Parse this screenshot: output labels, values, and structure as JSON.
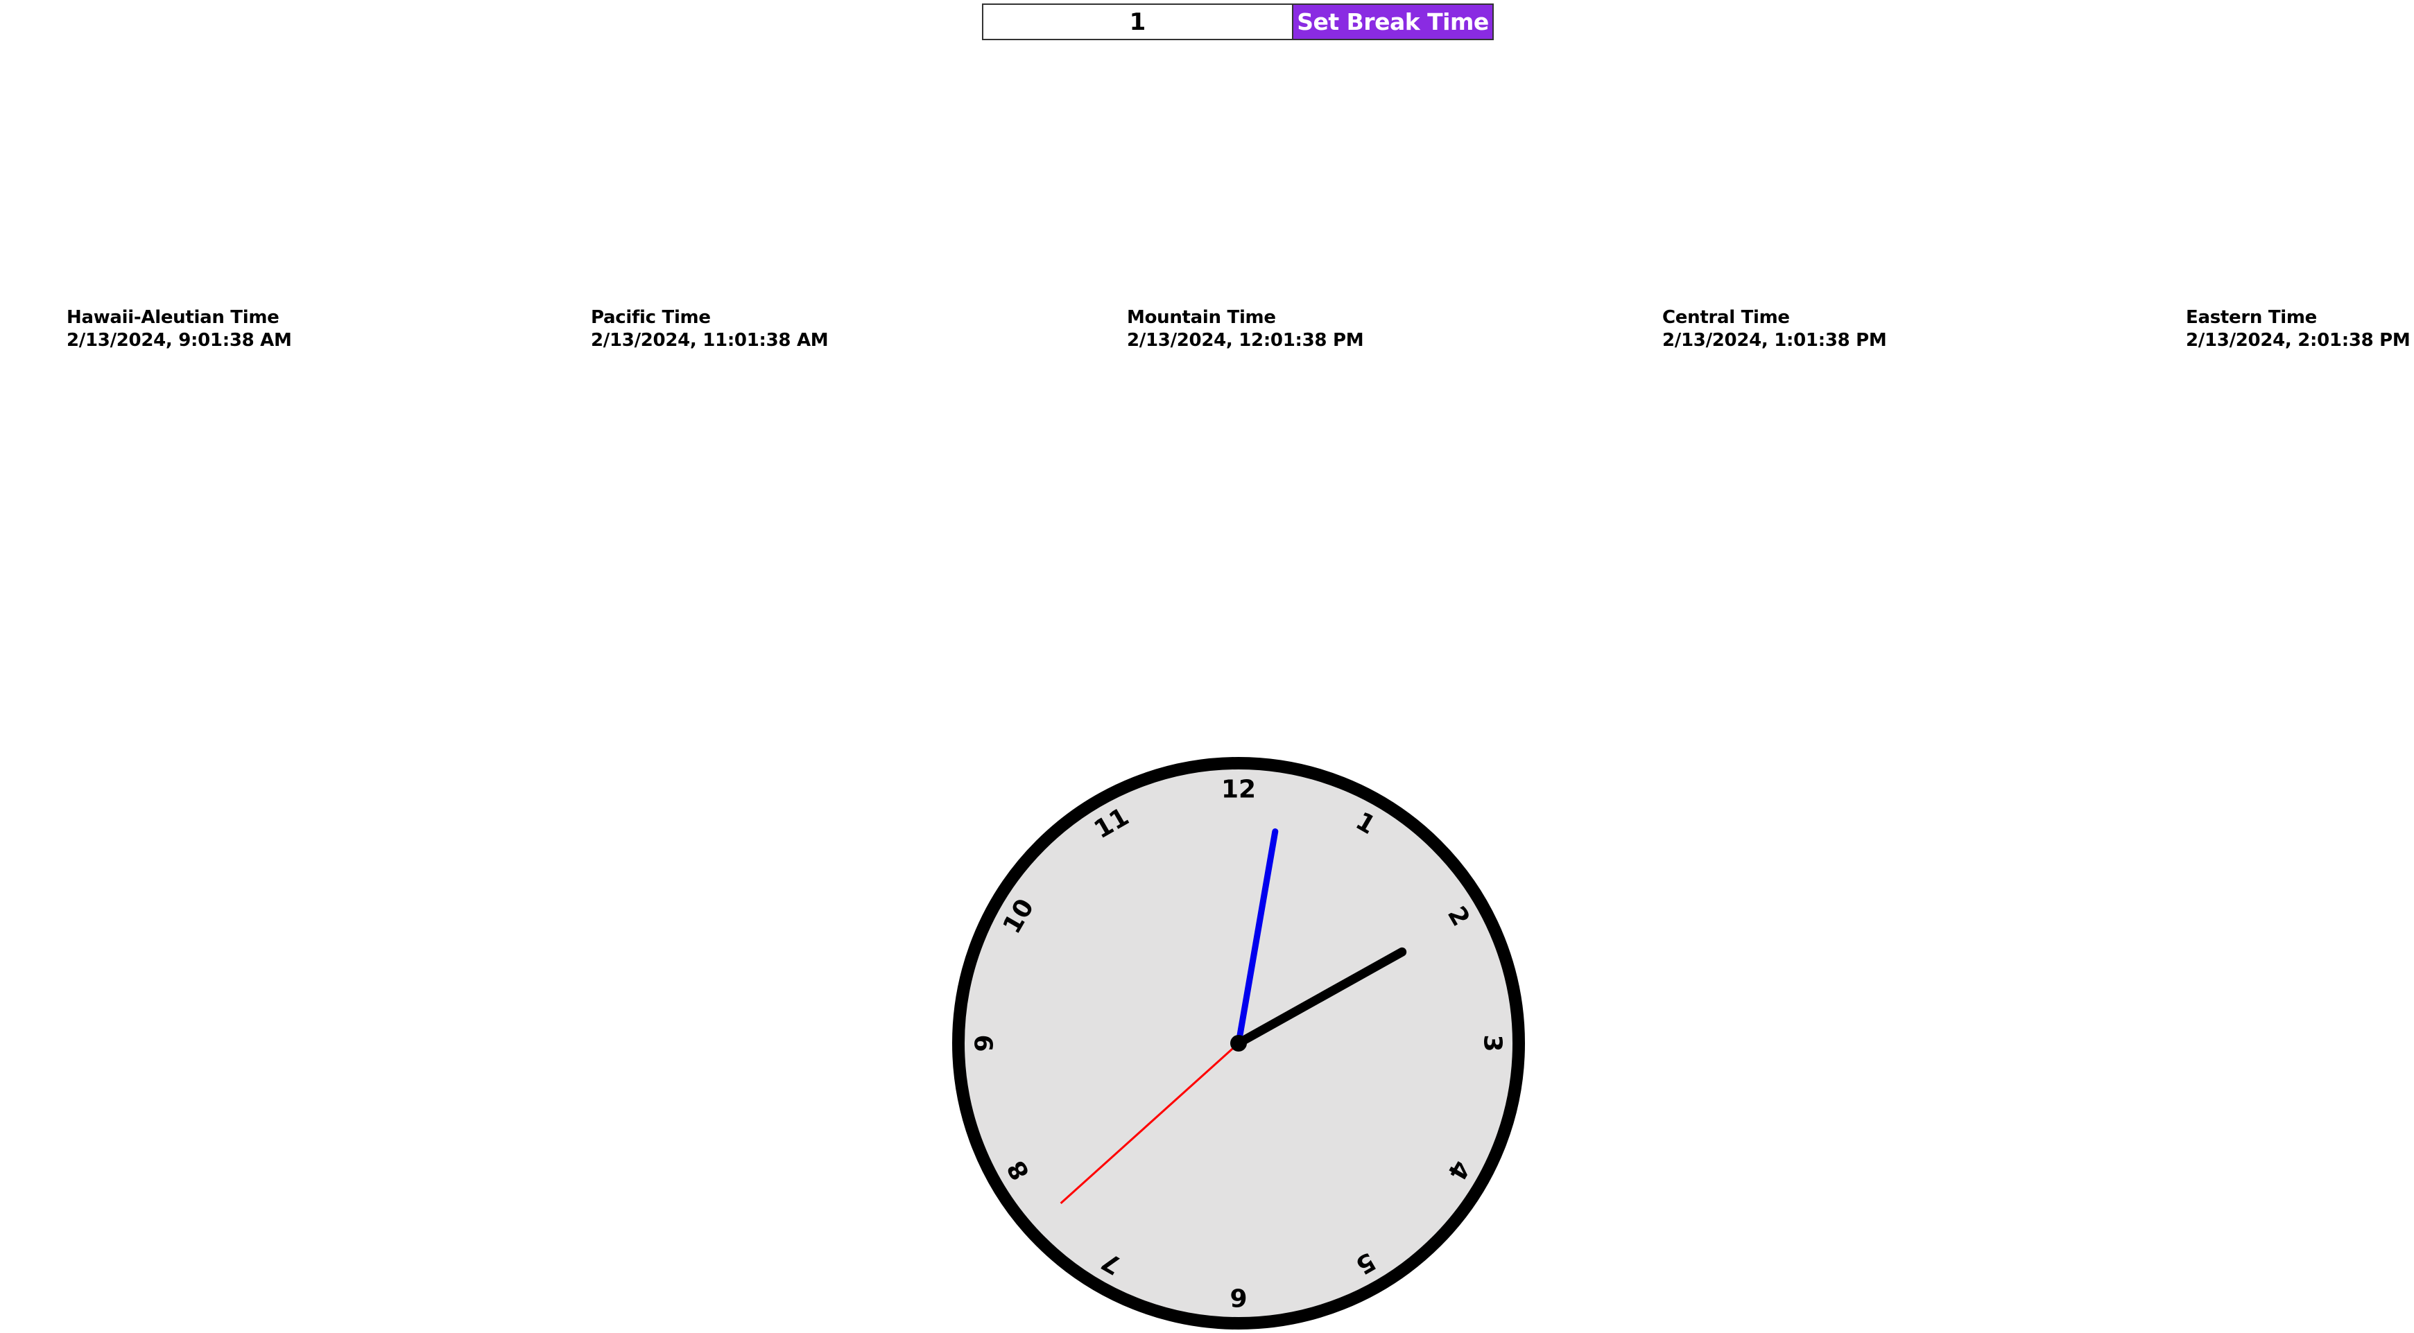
{
  "controls": {
    "break_minutes": "1",
    "set_button_label": "Set Break Time",
    "button_color": "#8a2be2"
  },
  "zones": [
    {
      "name": "Hawaii-Aleutian Time",
      "datetime": "2/13/2024, 9:01:38 AM"
    },
    {
      "name": "Pacific Time",
      "datetime": "2/13/2024, 11:01:38 AM"
    },
    {
      "name": "Mountain Time",
      "datetime": "2/13/2024, 12:01:38 PM"
    },
    {
      "name": "Central Time",
      "datetime": "2/13/2024, 1:01:38 PM"
    },
    {
      "name": "Eastern Time",
      "datetime": "2/13/2024, 2:01:38 PM"
    }
  ],
  "clock": {
    "hour": 2,
    "minute": 1,
    "second": 38,
    "numbers": [
      "12",
      "1",
      "2",
      "3",
      "4",
      "5",
      "6",
      "7",
      "8",
      "9",
      "10",
      "11"
    ],
    "face_color": "#e2e1e1",
    "rim_color": "#000000",
    "hour_hand_color": "#000000",
    "minute_hand_color": "#0000ee",
    "second_hand_color": "#ff0000"
  }
}
